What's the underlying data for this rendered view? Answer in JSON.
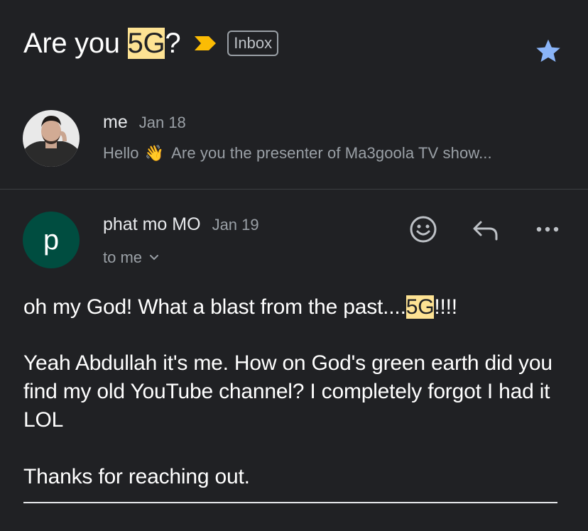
{
  "thread": {
    "subject_pre": "Are you ",
    "subject_hl": "5G",
    "subject_post": "?",
    "label": "Inbox",
    "important_color": "#fbbc04",
    "star_color": "#8ab4f8",
    "starred": true
  },
  "collapsed_message": {
    "sender": "me",
    "date": "Jan 18",
    "snippet_pre": "Hello",
    "snippet_emoji": "👋",
    "snippet_post": "Are you the presenter of Ma3goola TV show..."
  },
  "expanded_message": {
    "sender": "phat mo MO",
    "date": "Jan 19",
    "avatar_letter": "p",
    "avatar_color": "#004d40",
    "to_label": "to me",
    "body": {
      "p1_pre": "oh my God! What a blast from the past....",
      "p1_hl": "5G",
      "p1_post": "!!!!",
      "p2": "Yeah Abdullah it's me. How on God's green earth did you find my old YouTube channel? I completely forgot I had it LOL",
      "p3": "Thanks for reaching out."
    }
  }
}
